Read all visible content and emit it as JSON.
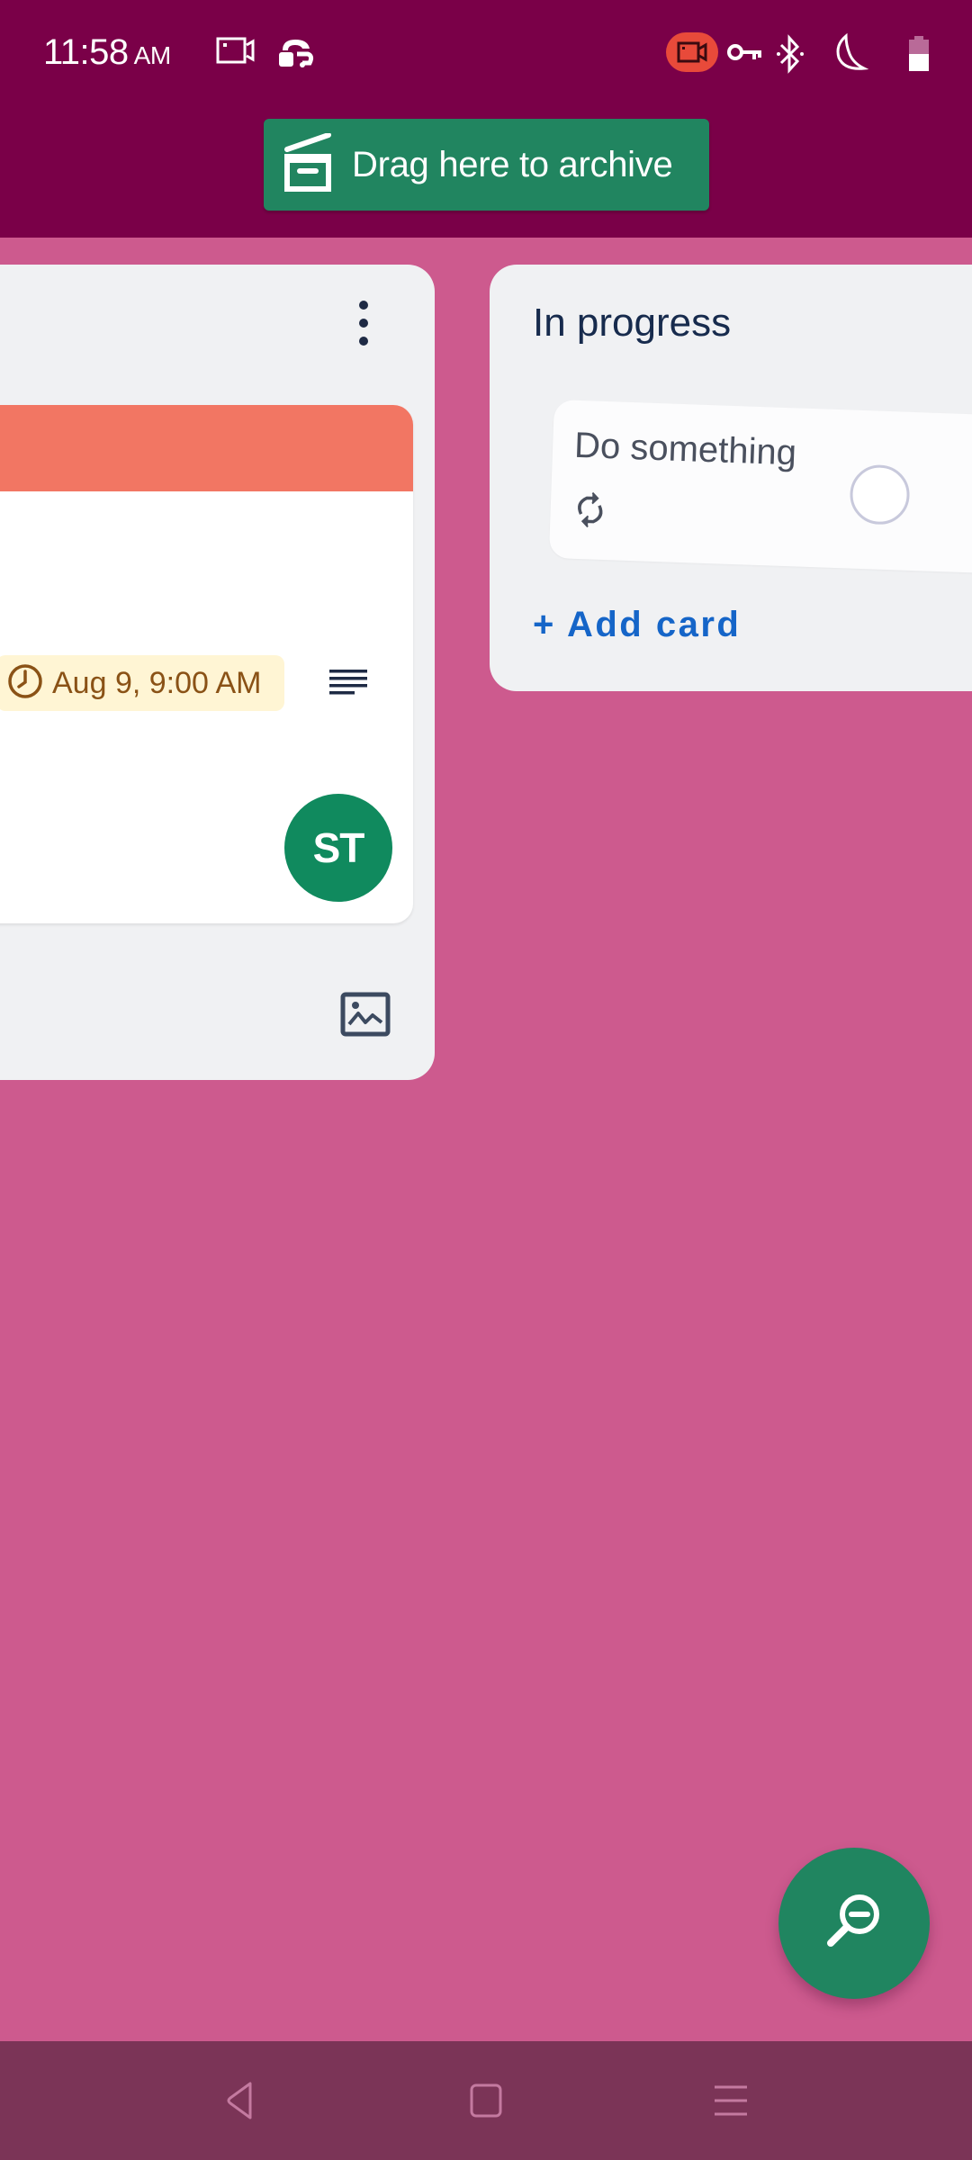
{
  "status_bar": {
    "time": "11:58",
    "ampm": "AM",
    "left_icons": [
      "screen-record-icon",
      "cloud-sync-icon"
    ],
    "right_icons": [
      "recording-indicator-icon",
      "vpn-key-icon",
      "bluetooth-icon",
      "do-not-disturb-moon-icon",
      "battery-icon"
    ]
  },
  "archive_zone": {
    "label": "Drag here to archive",
    "icon": "archive-box-icon"
  },
  "lists": [
    {
      "title": "",
      "menu_icon": "more-vertical-icon",
      "cards": [
        {
          "cover_color": "#f27663",
          "due": "Aug 9, 9:00 AM",
          "due_icon": "clock-icon",
          "has_description": true,
          "member_initials": "ST"
        }
      ],
      "footer_icon": "image-icon"
    },
    {
      "title": "In progress",
      "cards": [
        {
          "title": "Do something",
          "icon": "repeat-icon",
          "completed": false,
          "dragging": true
        }
      ],
      "add_card_label": "+ Add card"
    }
  ],
  "fab": {
    "icon": "zoom-out-icon"
  },
  "nav_bar": {
    "buttons": [
      "back-button",
      "home-button",
      "menu-button"
    ]
  },
  "colors": {
    "header": "#7a0048",
    "board_background": "#cd5a8e",
    "archive_green": "#218560",
    "avatar_green": "#108a5e",
    "link_blue": "#1565c8",
    "nav_bar": "#7b3457"
  }
}
